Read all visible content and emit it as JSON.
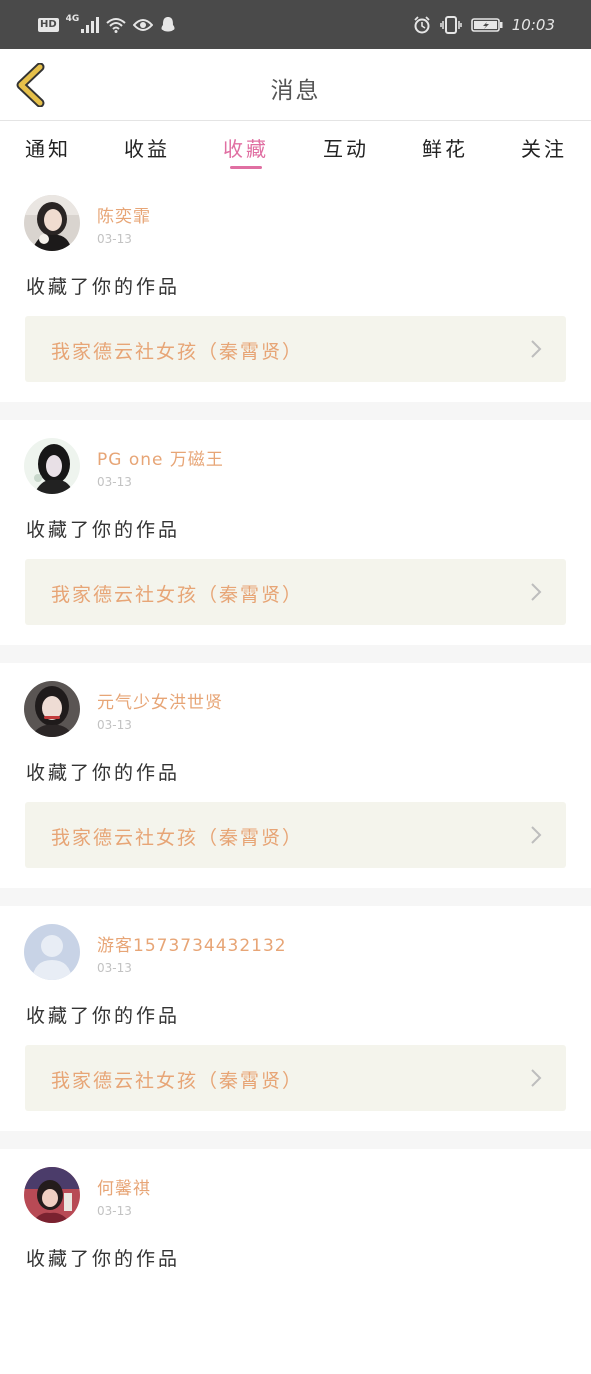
{
  "status_bar": {
    "hd": "HD",
    "network": "4G",
    "time": "10:03",
    "icons": [
      "hd-icon",
      "signal-icon",
      "wifi-icon",
      "eye-icon",
      "qq-icon",
      "alarm-icon",
      "vibrate-icon",
      "battery-icon"
    ]
  },
  "header": {
    "title": "消息",
    "back_icon": "chevron-left-icon",
    "accent_color": "#e6c04a"
  },
  "tabs": [
    {
      "label": "通知",
      "active": false
    },
    {
      "label": "收益",
      "active": false
    },
    {
      "label": "收藏",
      "active": true
    },
    {
      "label": "互动",
      "active": false
    },
    {
      "label": "鲜花",
      "active": false
    },
    {
      "label": "关注",
      "active": false
    }
  ],
  "active_color": "#e06fa2",
  "messages": [
    {
      "user": "陈奕霏",
      "date": "03-13",
      "text": "收藏了你的作品",
      "work": "我家德云社女孩（秦霄贤）"
    },
    {
      "user": "PG one 万磁王",
      "date": "03-13",
      "text": "收藏了你的作品",
      "work": "我家德云社女孩（秦霄贤）"
    },
    {
      "user": "元气少女洪世贤",
      "date": "03-13",
      "text": "收藏了你的作品",
      "work": "我家德云社女孩（秦霄贤）"
    },
    {
      "user": "游客1573734432132",
      "date": "03-13",
      "text": "收藏了你的作品",
      "work": "我家德云社女孩（秦霄贤）"
    },
    {
      "user": "何馨祺",
      "date": "03-13",
      "text": "收藏了你的作品",
      "work": ""
    }
  ]
}
